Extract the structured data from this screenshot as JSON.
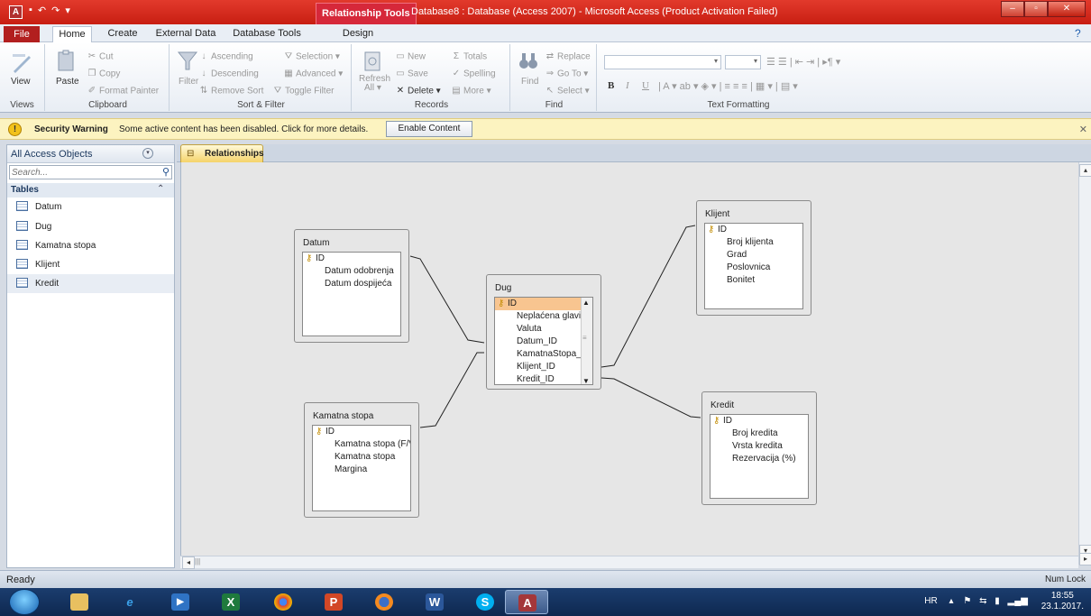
{
  "titlebar": {
    "app_icon": "A",
    "context_tab": "Relationship Tools",
    "title": "Database8 : Database (Access 2007)  -  Microsoft Access (Product Activation Failed)",
    "minimize_glyph": "–",
    "maximize_glyph": "▫",
    "close_glyph": "✕"
  },
  "tabs": {
    "file": "File",
    "items": [
      "Home",
      "Create",
      "External Data",
      "Database Tools",
      "Design"
    ]
  },
  "ribbon": {
    "views": {
      "view": "View",
      "label": "Views"
    },
    "clipboard": {
      "paste": "Paste",
      "cut": "Cut",
      "copy": "Copy",
      "format_painter": "Format Painter",
      "label": "Clipboard"
    },
    "sort_filter": {
      "filter": "Filter",
      "ascending": "Ascending",
      "descending": "Descending",
      "remove_sort": "Remove Sort",
      "selection": "Selection",
      "advanced": "Advanced",
      "toggle_filter": "Toggle Filter",
      "label": "Sort & Filter"
    },
    "records": {
      "refresh": "Refresh",
      "refresh_all": "All",
      "new": "New",
      "save": "Save",
      "delete": "Delete",
      "totals": "Totals",
      "spelling": "Spelling",
      "more": "More",
      "label": "Records"
    },
    "find": {
      "find": "Find",
      "replace": "Replace",
      "goto": "Go To",
      "select": "Select",
      "label": "Find"
    },
    "text_formatting": {
      "bold": "B",
      "italic": "I",
      "underline": "U",
      "label": "Text Formatting"
    }
  },
  "security": {
    "title": "Security Warning",
    "message": "Some active content has been disabled. Click for more details.",
    "button": "Enable Content"
  },
  "nav": {
    "title": "All Access Objects",
    "search_placeholder": "Search...",
    "group": "Tables",
    "items": [
      "Datum",
      "Dug",
      "Kamatna stopa",
      "Klijent",
      "Kredit"
    ]
  },
  "document": {
    "tab": "Relationships"
  },
  "tables": {
    "datum": {
      "name": "Datum",
      "fields": [
        "ID",
        "Datum odobrenja",
        "Datum dospijeća"
      ]
    },
    "dug": {
      "name": "Dug",
      "fields": [
        "ID",
        "Neplaćena glavi",
        "Valuta",
        "Datum_ID",
        "KamatnaStopa_",
        "Klijent_ID",
        "Kredit_ID"
      ]
    },
    "klijent": {
      "name": "Klijent",
      "fields": [
        "ID",
        "Broj klijenta",
        "Grad",
        "Poslovnica",
        "Bonitet"
      ]
    },
    "kamatna": {
      "name": "Kamatna stopa",
      "fields": [
        "ID",
        "Kamatna stopa (F/V",
        "Kamatna stopa",
        "Margina"
      ]
    },
    "kredit": {
      "name": "Kredit",
      "fields": [
        "ID",
        "Broj kredita",
        "Vrsta kredita",
        "Rezervacija (%)"
      ]
    }
  },
  "statusbar": {
    "left": "Ready",
    "right": "Num Lock"
  },
  "taskbar": {
    "tray_lang": "HR",
    "time": "18:55",
    "date": "23.1.2017."
  }
}
